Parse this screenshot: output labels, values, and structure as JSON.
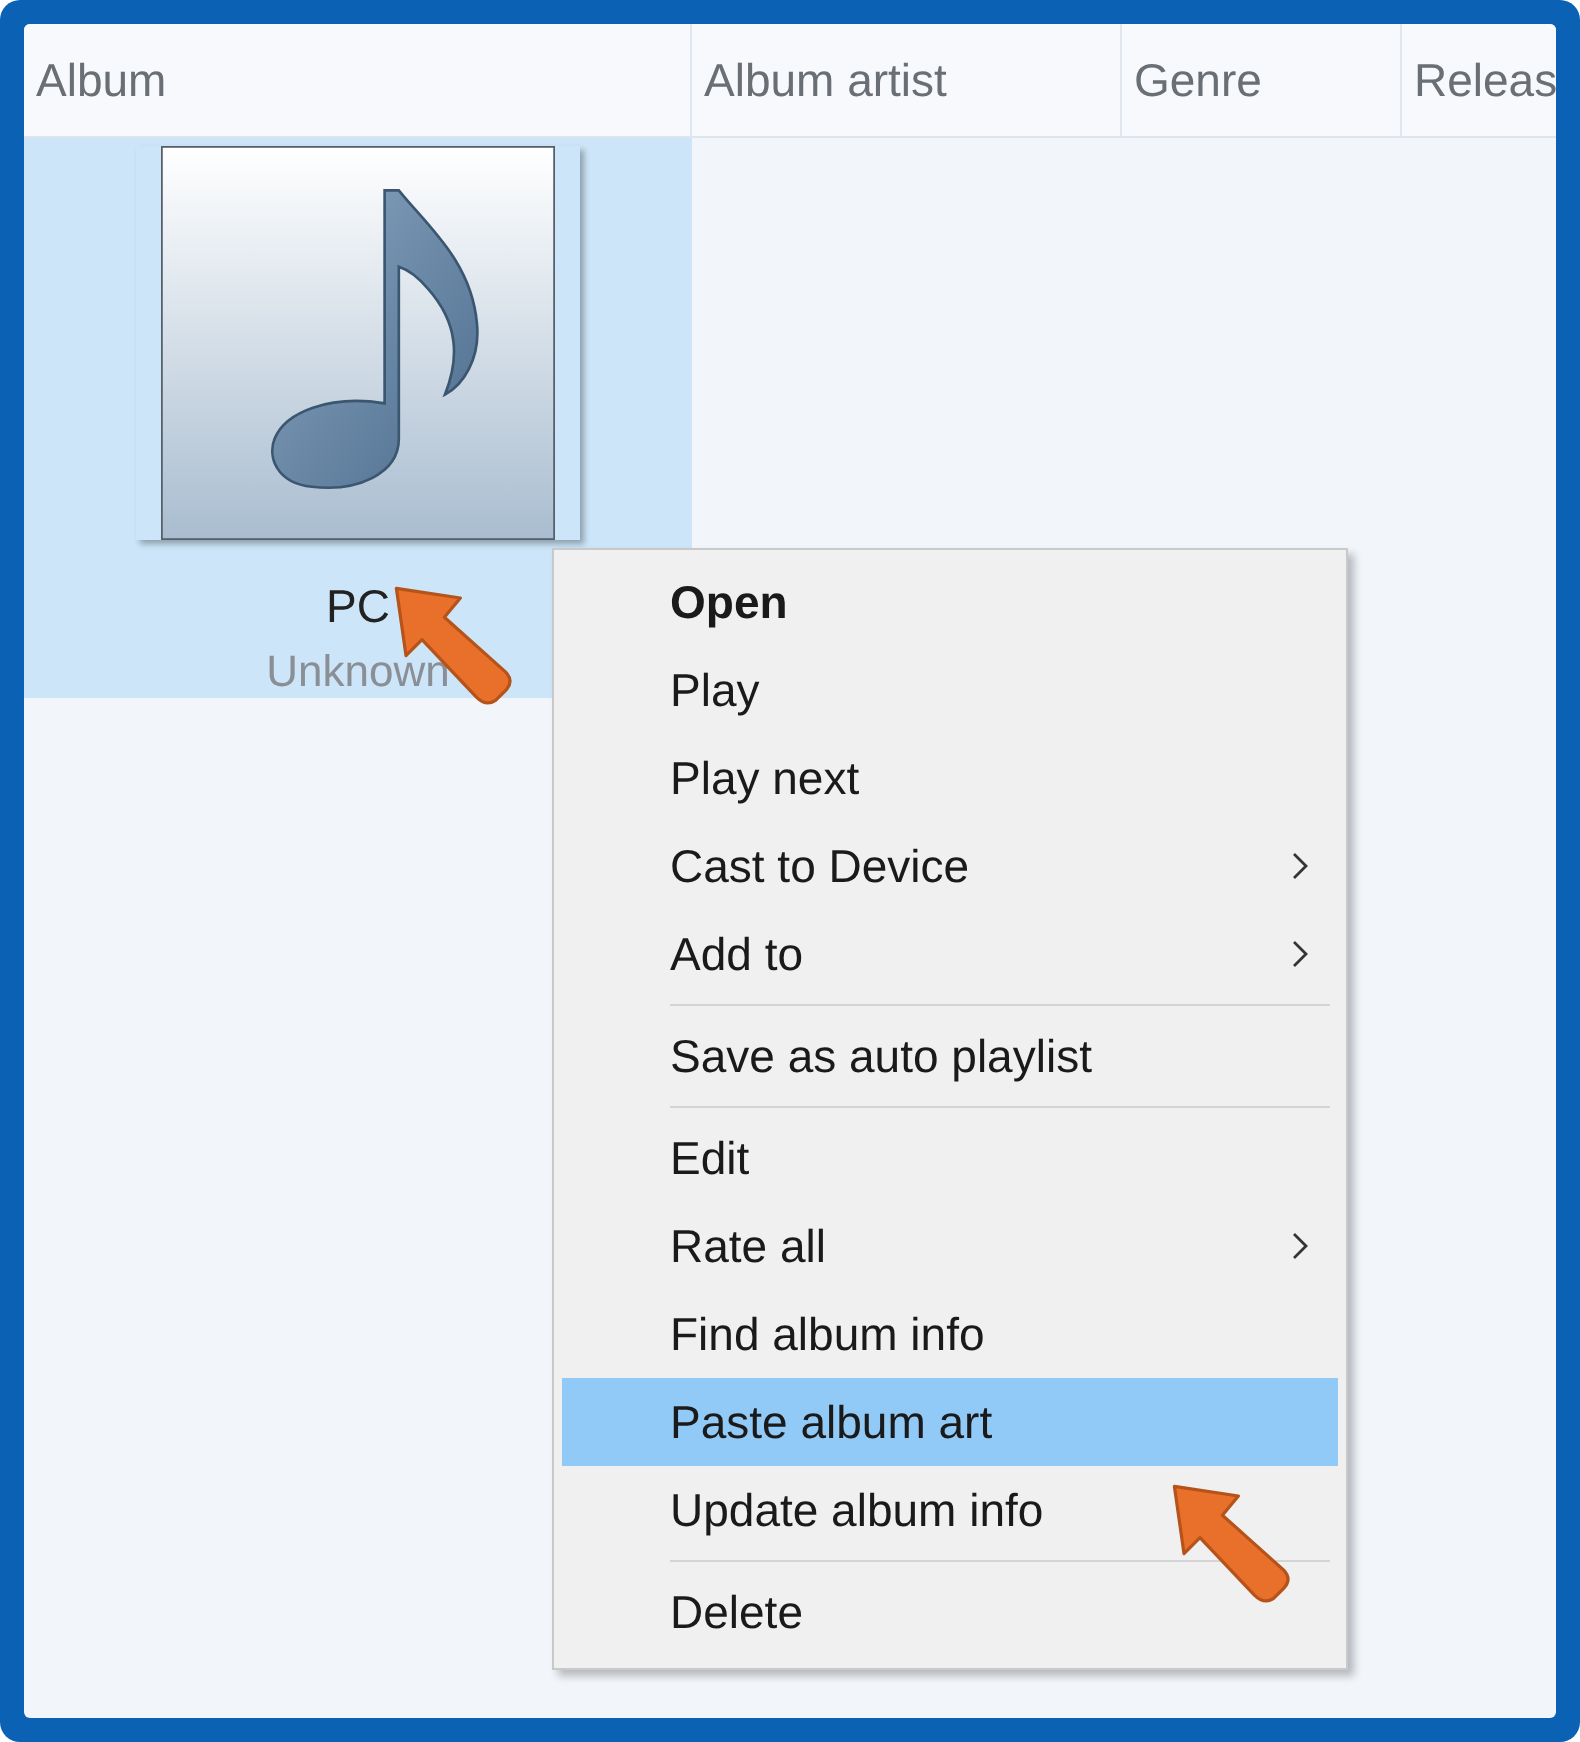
{
  "columns": [
    {
      "label": "Album"
    },
    {
      "label": "Album artist"
    },
    {
      "label": "Genre"
    },
    {
      "label": "Releas"
    }
  ],
  "album": {
    "title": "PC",
    "artist": "Unknown",
    "selected": true
  },
  "context_menu": {
    "items": [
      {
        "kind": "item",
        "label": "Open",
        "bold": true,
        "submenu": false,
        "selected": false
      },
      {
        "kind": "item",
        "label": "Play",
        "bold": false,
        "submenu": false,
        "selected": false
      },
      {
        "kind": "item",
        "label": "Play next",
        "bold": false,
        "submenu": false,
        "selected": false
      },
      {
        "kind": "item",
        "label": "Cast to Device",
        "bold": false,
        "submenu": true,
        "selected": false
      },
      {
        "kind": "item",
        "label": "Add to",
        "bold": false,
        "submenu": true,
        "selected": false
      },
      {
        "kind": "separator"
      },
      {
        "kind": "item",
        "label": "Save as auto playlist",
        "bold": false,
        "submenu": false,
        "selected": false
      },
      {
        "kind": "separator"
      },
      {
        "kind": "item",
        "label": "Edit",
        "bold": false,
        "submenu": false,
        "selected": false
      },
      {
        "kind": "item",
        "label": "Rate all",
        "bold": false,
        "submenu": true,
        "selected": false
      },
      {
        "kind": "item",
        "label": "Find album info",
        "bold": false,
        "submenu": false,
        "selected": false
      },
      {
        "kind": "item",
        "label": "Paste album art",
        "bold": false,
        "submenu": false,
        "selected": true
      },
      {
        "kind": "item",
        "label": "Update album info",
        "bold": false,
        "submenu": false,
        "selected": false
      },
      {
        "kind": "separator"
      },
      {
        "kind": "item",
        "label": "Delete",
        "bold": false,
        "submenu": false,
        "selected": false
      }
    ]
  }
}
